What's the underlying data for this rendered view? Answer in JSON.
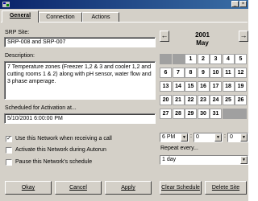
{
  "window": {
    "title": ""
  },
  "tabs": [
    {
      "label": "General",
      "active": true
    },
    {
      "label": "Connection",
      "active": false
    },
    {
      "label": "Actions",
      "active": false
    }
  ],
  "form": {
    "srp_site_label": "SRP Site:",
    "srp_site_value": "SRP-008 and SRP-007",
    "description_label": "Description:",
    "description_value": "7 Temperature zones (Freezer 1,2 & 3 and cooler 1,2 and cutting rooms 1 & 2) along with pH sensor, water flow and 3 phase amperage.",
    "scheduled_label": "Scheduled for Activation at...",
    "scheduled_value": "5/10/2001 6:00:00 PM"
  },
  "checkboxes": [
    {
      "label": "Use this Network when receiving a call",
      "checked": true
    },
    {
      "label": "Activate this Network during Autorun",
      "checked": false
    },
    {
      "label": "Pause this Network's schedule",
      "checked": false
    }
  ],
  "calendar": {
    "year": "2001",
    "month": "May",
    "rows": [
      [
        "",
        "",
        "1",
        "2",
        "3",
        "4",
        "5"
      ],
      [
        "6",
        "7",
        "8",
        "9",
        "10",
        "11",
        "12"
      ],
      [
        "13",
        "14",
        "15",
        "16",
        "17",
        "18",
        "19"
      ],
      [
        "20",
        "21",
        "22",
        "23",
        "24",
        "25",
        "26"
      ],
      [
        "27",
        "28",
        "29",
        "30",
        "31",
        "",
        ""
      ]
    ]
  },
  "time": {
    "hour": "6 PM",
    "minute": "0",
    "second": "0"
  },
  "repeat": {
    "label": "Repeat every...",
    "value": "1 day"
  },
  "buttons": {
    "okay": "Okay",
    "cancel": "Cancel",
    "apply": "Apply",
    "clear_schedule": "Clear Schedule",
    "delete_site": "Delete Site"
  },
  "colors": {
    "titlebar": "#0a246a",
    "face": "#d4d0c8",
    "calendar_empty": "#a0a0a0"
  }
}
